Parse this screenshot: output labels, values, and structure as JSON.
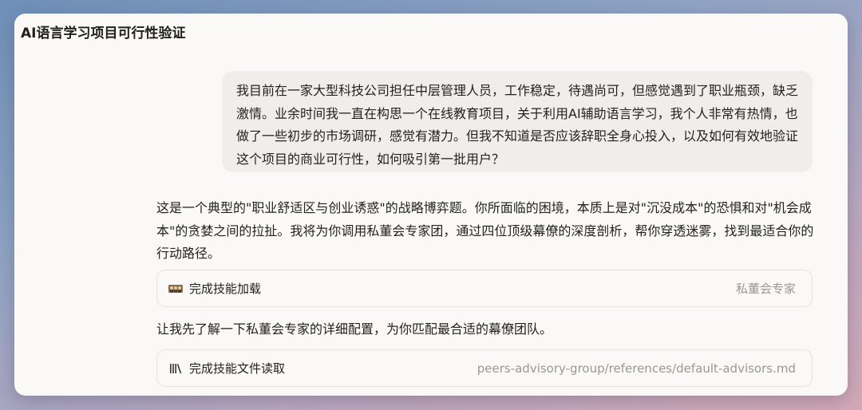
{
  "window": {
    "title": "AI语言学习项目可行性验证"
  },
  "messages": {
    "user": "我目前在一家大型科技公司担任中层管理人员，工作稳定，待遇尚可，但感觉遇到了职业瓶颈，缺乏激情。业余时间我一直在构思一个在线教育项目，关于利用AI辅助语言学习，我个人非常有热情，也做了一些初步的市场调研，感觉有潜力。但我不知道是否应该辞职全身心投入，以及如何有效地验证这个项目的商业可行性，如何吸引第一批用户？",
    "assistant_intro": "这是一个典型的\"职业舒适区与创业诱惑\"的战略博弈题。你所面临的困境，本质上是对\"沉没成本\"的恐惧和对\"机会成本\"的贪婪之间的拉扯。我将为你调用私董会专家团，通过四位顶级幕僚的深度剖析，帮你穿透迷雾，找到最适合你的行动路径。",
    "assistant_followup": "让我先了解一下私董会专家的详细配置，为你匹配最合适的幕僚团队。"
  },
  "tool_cards": [
    {
      "icon": "team-avatars-icon",
      "label": "完成技能加载",
      "detail": "私董会专家"
    },
    {
      "icon": "library-icon",
      "label": "完成技能文件读取",
      "detail": "peers-advisory-group/references/default-advisors.md"
    }
  ]
}
